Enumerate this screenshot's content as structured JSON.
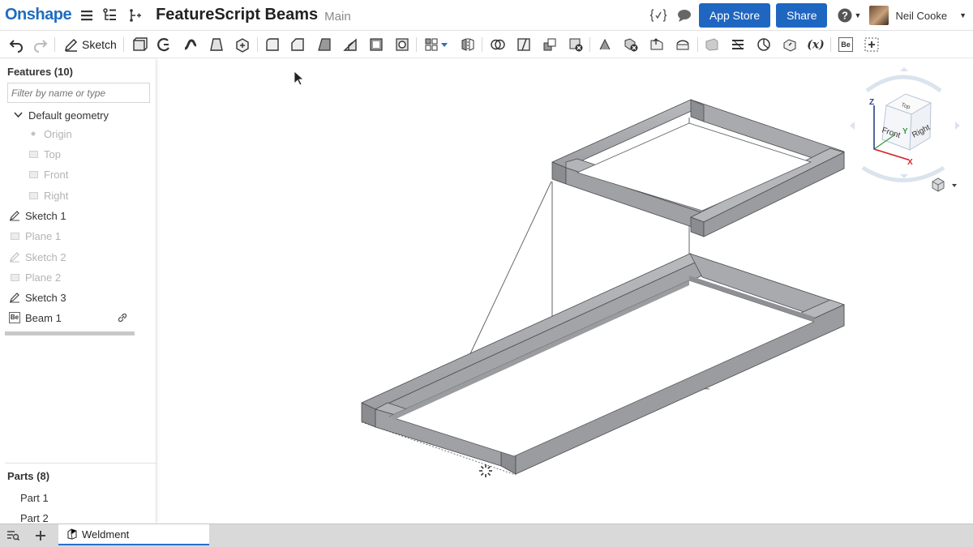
{
  "app": {
    "logo": "Onshape"
  },
  "document": {
    "title": "FeatureScript Beams",
    "branch": "Main"
  },
  "header": {
    "app_store_label": "App Store",
    "share_label": "Share",
    "user_name": "Neil Cooke"
  },
  "toolbar": {
    "sketch_label": "Sketch"
  },
  "feature_panel": {
    "title": "Features (10)",
    "filter_placeholder": "Filter by name or type",
    "items": [
      {
        "label": "Default geometry",
        "icon": "chevron-down-icon",
        "state": "expanded"
      },
      {
        "label": "Origin",
        "icon": "origin-dot-icon",
        "state": "hidden"
      },
      {
        "label": "Top",
        "icon": "plane-icon",
        "state": "hidden"
      },
      {
        "label": "Front",
        "icon": "plane-icon",
        "state": "hidden"
      },
      {
        "label": "Right",
        "icon": "plane-icon",
        "state": "hidden"
      },
      {
        "label": "Sketch 1",
        "icon": "pencil-icon",
        "state": "visible"
      },
      {
        "label": "Plane 1",
        "icon": "plane-icon",
        "state": "hidden"
      },
      {
        "label": "Sketch 2",
        "icon": "pencil-icon",
        "state": "hidden"
      },
      {
        "label": "Plane 2",
        "icon": "plane-icon",
        "state": "hidden"
      },
      {
        "label": "Sketch 3",
        "icon": "pencil-icon",
        "state": "visible"
      },
      {
        "label": "Beam 1",
        "icon": "be-icon",
        "state": "visible"
      }
    ],
    "be_glyph": "Be"
  },
  "parts_panel": {
    "title": "Parts (8)",
    "items": [
      "Part 1",
      "Part 2"
    ]
  },
  "view_cube": {
    "top": "Top",
    "front": "Front",
    "right": "Right",
    "axis_x": "X",
    "axis_y": "Y",
    "axis_z": "Z"
  },
  "bottom_tabs": {
    "active_tab": "Weldment"
  },
  "colors": {
    "accent": "#1f66c1",
    "logo": "#1f6dbf",
    "beam_fill": "#a9abae",
    "beam_dark": "#7f8185"
  }
}
